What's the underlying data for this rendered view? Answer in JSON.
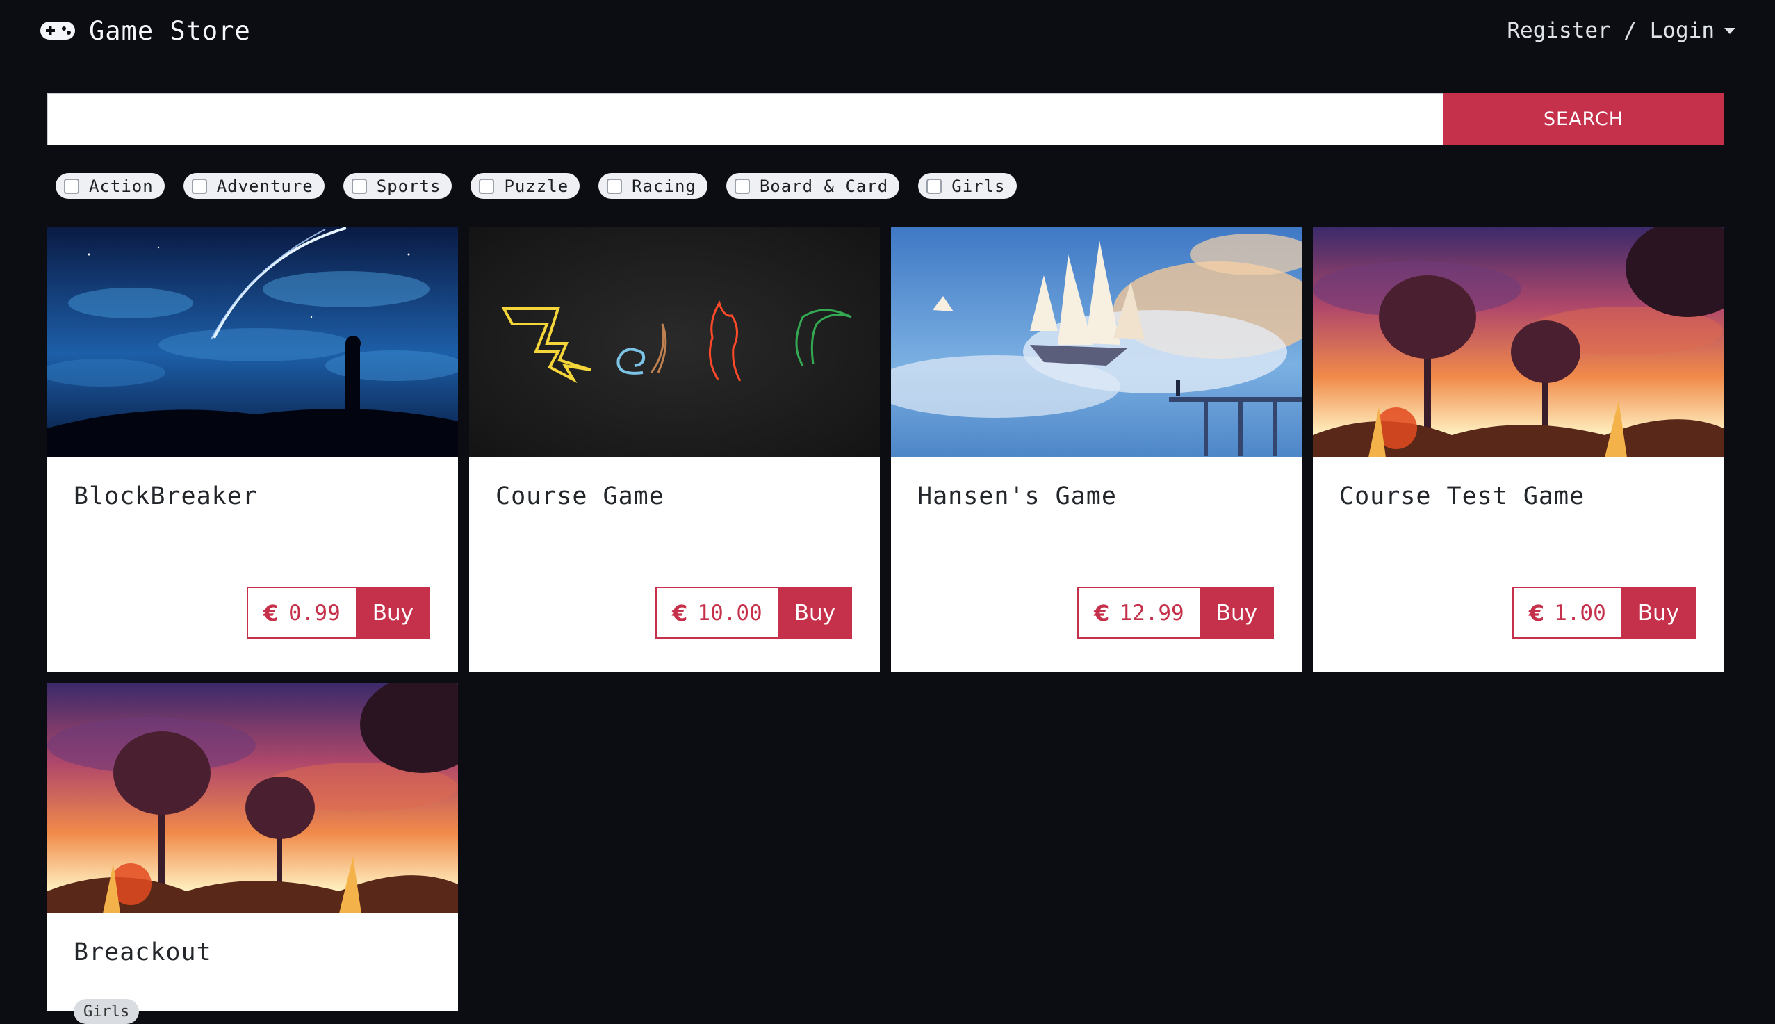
{
  "navbar": {
    "brand": "Game Store",
    "account": "Register / Login"
  },
  "search": {
    "value": "",
    "placeholder": "",
    "button": "SEARCH"
  },
  "filters": [
    "Action",
    "Adventure",
    "Sports",
    "Puzzle",
    "Racing",
    "Board & Card",
    "Girls"
  ],
  "games": [
    {
      "title": "BlockBreaker",
      "currency": "€",
      "price": "0.99",
      "buy": "Buy",
      "image": "night-sky-comet-image"
    },
    {
      "title": "Course Game",
      "currency": "€",
      "price": "10.00",
      "buy": "Buy",
      "image": "pokemon-outlines-image"
    },
    {
      "title": "Hansen's Game",
      "currency": "€",
      "price": "12.99",
      "buy": "Buy",
      "image": "sky-ship-image"
    },
    {
      "title": "Course Test Game",
      "currency": "€",
      "price": "1.00",
      "buy": "Buy",
      "image": "sunset-trees-image"
    },
    {
      "title": "Breackout",
      "tag": "Girls",
      "image": "sunset-trees-image"
    }
  ],
  "colors": {
    "background": "#0b0d12",
    "accent": "#c5304a",
    "card": "#ffffff"
  }
}
